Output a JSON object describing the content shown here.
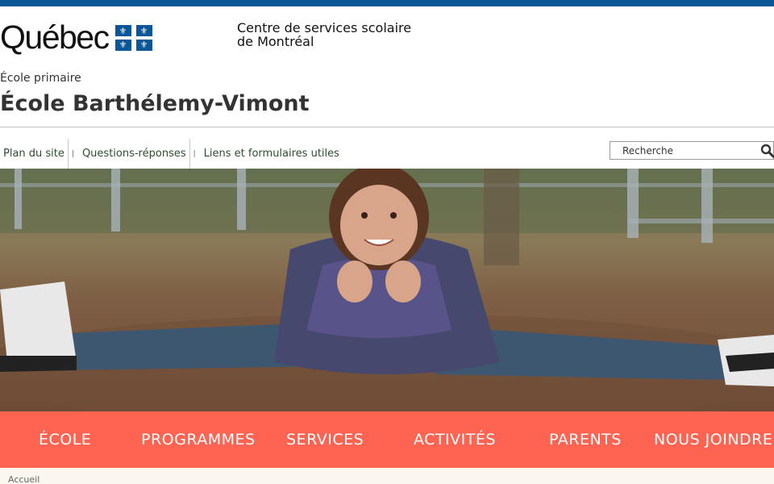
{
  "header": {
    "logo_text": "Québec",
    "org_line1": "Centre de services scolaire",
    "org_line2": "de Montréal"
  },
  "school": {
    "type": "École primaire",
    "name": "École Barthélemy-Vimont"
  },
  "util_nav": {
    "items": [
      {
        "label": "Plan du site"
      },
      {
        "label": "Questions-réponses"
      },
      {
        "label": "Liens et formulaires utiles"
      }
    ],
    "separator": "|"
  },
  "search": {
    "placeholder": "Recherche",
    "icon": "search-icon"
  },
  "main_nav": {
    "items": [
      {
        "label": "ÉCOLE"
      },
      {
        "label": "PROGRAMMES"
      },
      {
        "label": "SERVICES"
      },
      {
        "label": "ACTIVITÉS"
      },
      {
        "label": "PARENTS"
      },
      {
        "label": "NOUS JOINDRE"
      }
    ]
  },
  "breadcrumb": {
    "home": "Accueil"
  },
  "colors": {
    "top_bar": "#095797",
    "nav_bg": "#fe6451",
    "link": "#2e4d2e"
  }
}
